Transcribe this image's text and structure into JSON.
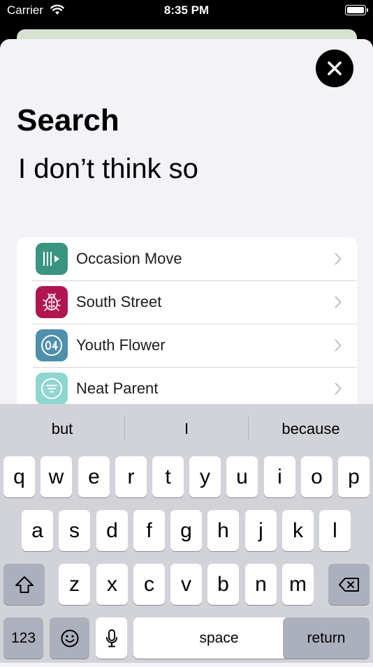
{
  "status_bar": {
    "carrier": "Carrier",
    "time": "8:35 PM"
  },
  "sheet": {
    "title": "Search",
    "query": "I don’t think so"
  },
  "results": [
    {
      "label": "Occasion Move",
      "icon": "audio-waveform-play-icon",
      "color": "#3a9480"
    },
    {
      "label": "South Street",
      "icon": "ladybug-icon",
      "color": "#b01550"
    },
    {
      "label": "Youth Flower",
      "icon": "number-04-icon",
      "color": "#4e8fac"
    },
    {
      "label": "Neat Parent",
      "icon": "lines-circle-icon",
      "color": "#8fd6cf"
    }
  ],
  "keyboard": {
    "suggestions": [
      "but",
      "I",
      "because"
    ],
    "row1": [
      "q",
      "w",
      "e",
      "r",
      "t",
      "y",
      "u",
      "i",
      "o",
      "p"
    ],
    "row2": [
      "a",
      "s",
      "d",
      "f",
      "g",
      "h",
      "j",
      "k",
      "l"
    ],
    "row3": [
      "z",
      "x",
      "c",
      "v",
      "b",
      "n",
      "m"
    ],
    "numbers_label": "123",
    "space_label": "space",
    "return_label": "return"
  }
}
